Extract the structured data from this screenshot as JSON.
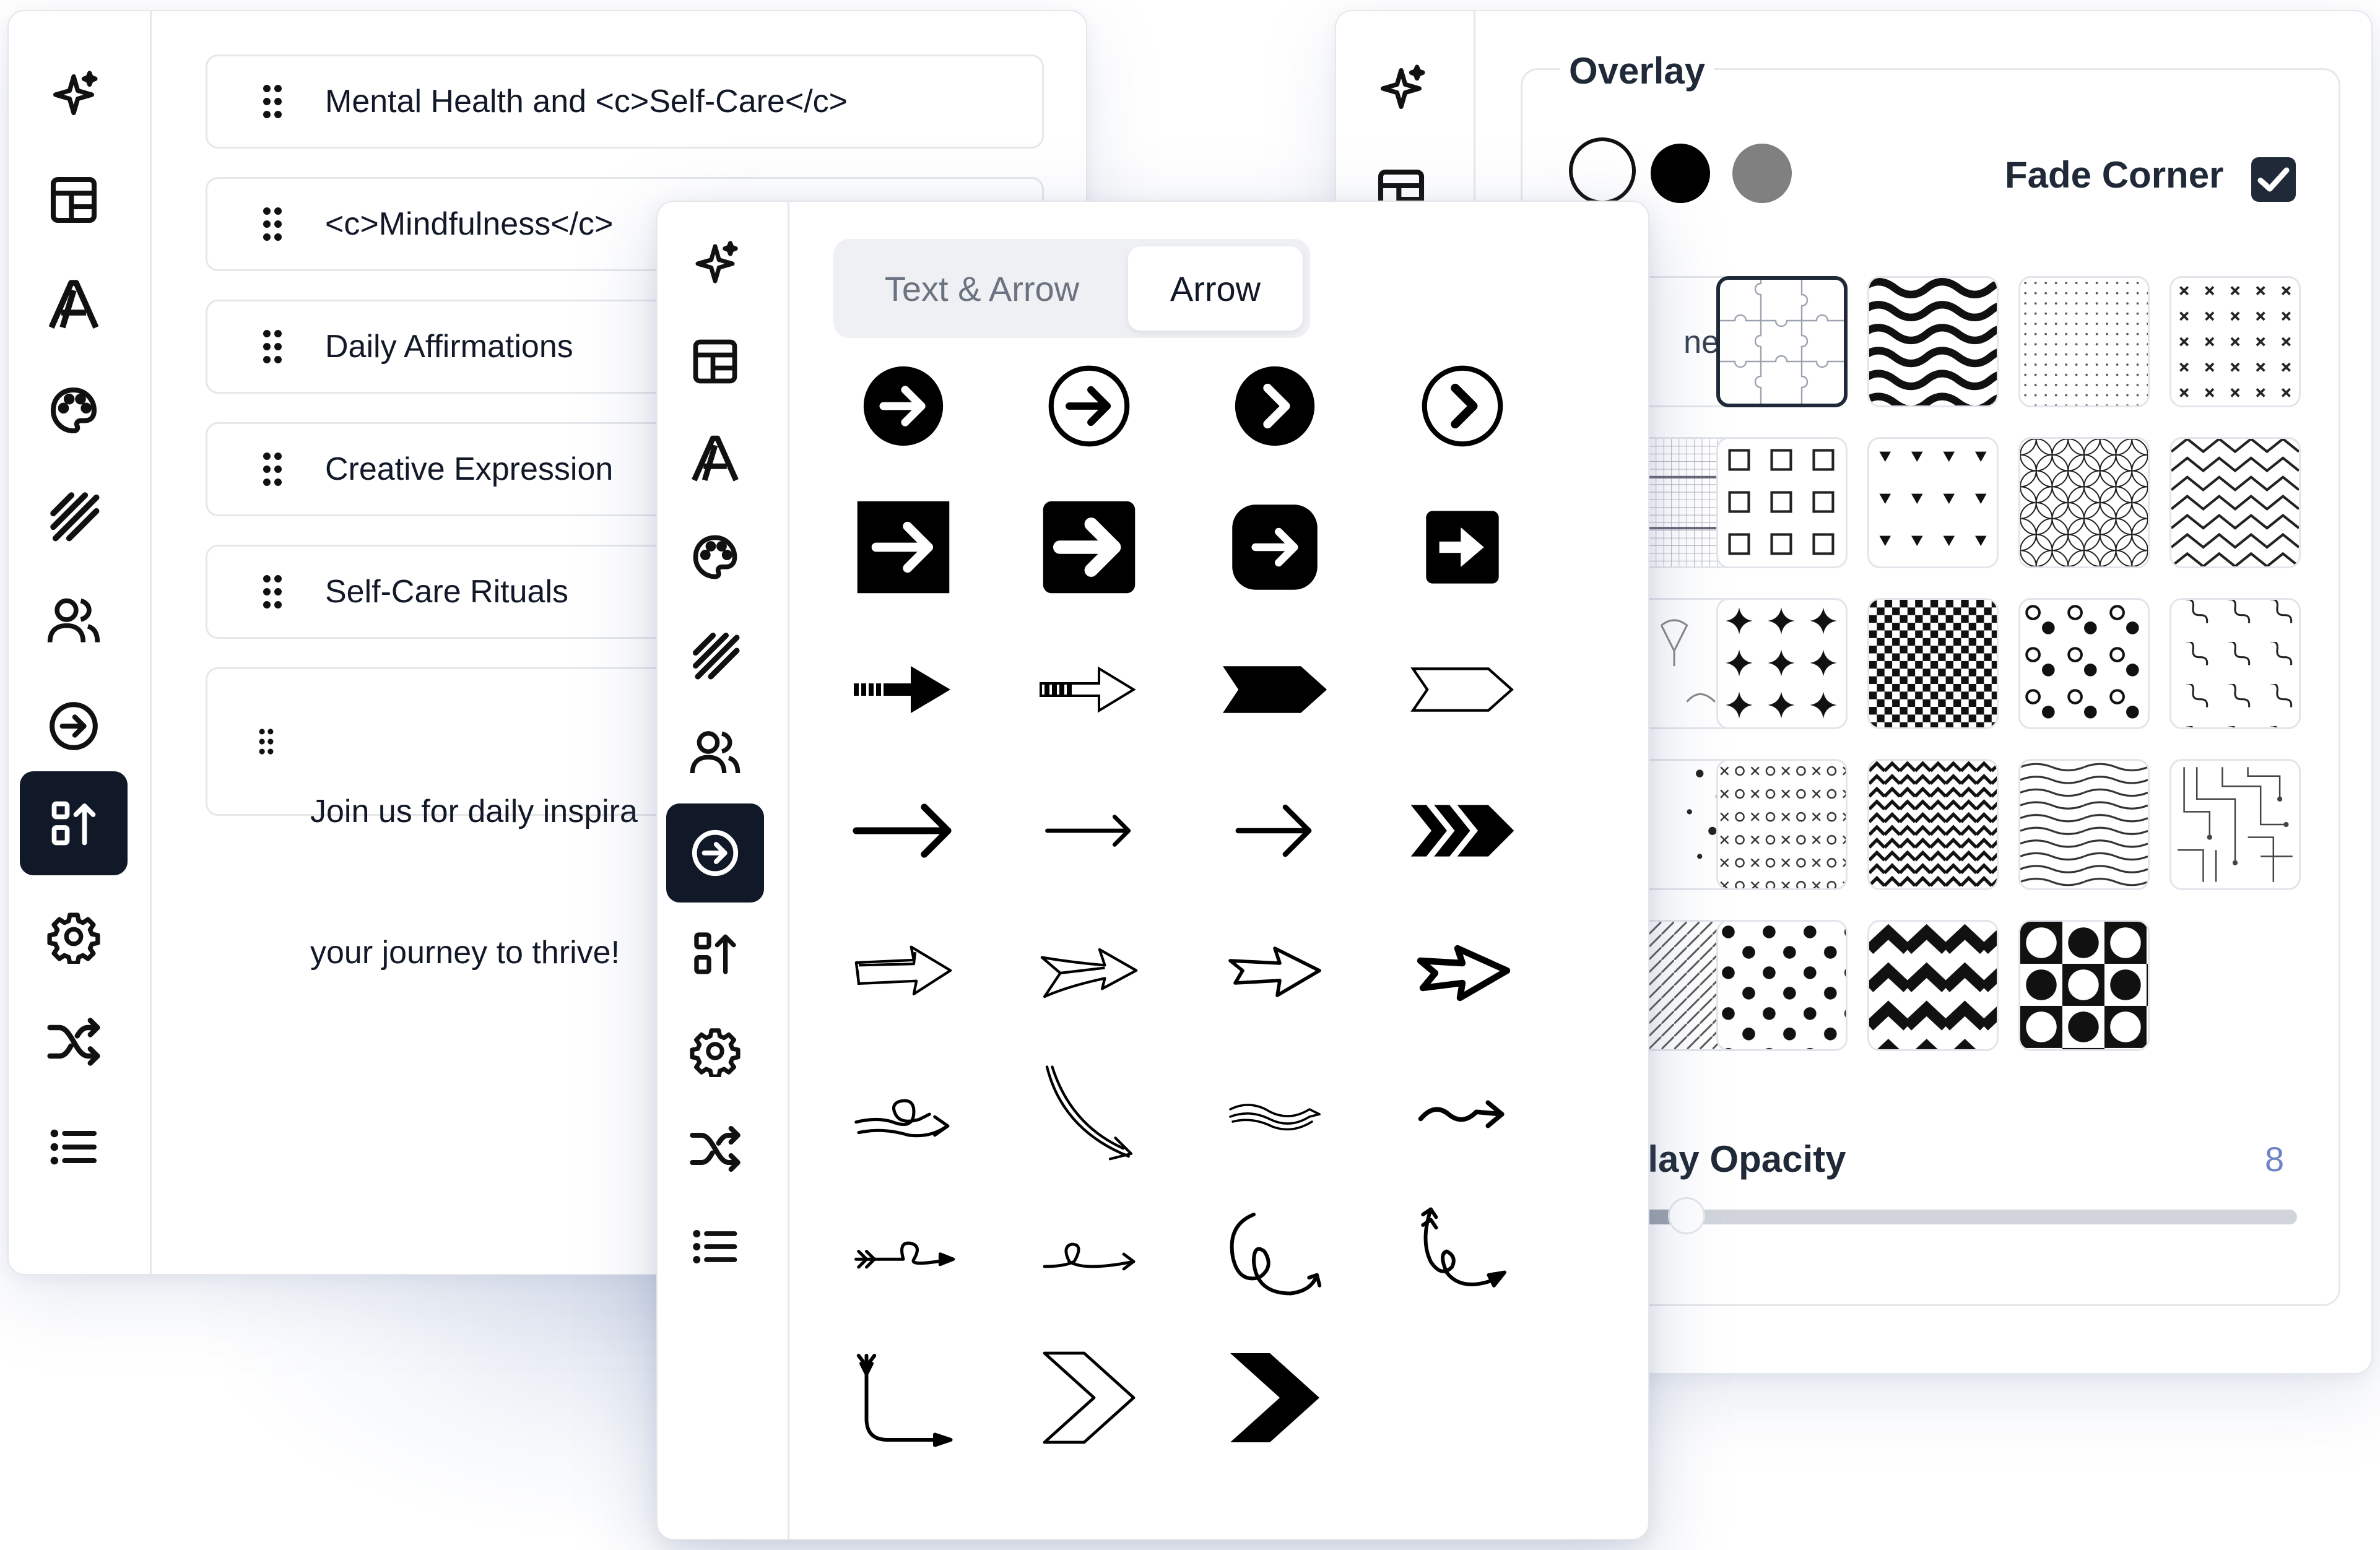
{
  "left_panel": {
    "rail_icons": [
      "sparkle-icon",
      "layout-icon",
      "font-icon",
      "palette-icon",
      "hatch-pattern-icon",
      "users-icon",
      "arrow-circle-icon",
      "sort-icon",
      "gear-icon",
      "shuffle-icon",
      "list-icon"
    ],
    "active_rail_icon": "sort-icon",
    "cards": [
      {
        "text": "Mental Health and <c>Self-Care</c>"
      },
      {
        "text": "<c>Mindfulness</c>"
      },
      {
        "text": "Daily Affirmations"
      },
      {
        "text": "Creative Expression"
      },
      {
        "text": "Self-Care Rituals"
      },
      {
        "line1": "Join us for daily inspira",
        "line2": "your journey to thrive!"
      }
    ]
  },
  "middle_panel": {
    "rail_icons": [
      "sparkle-icon",
      "layout-icon",
      "font-icon",
      "palette-icon",
      "hatch-pattern-icon",
      "users-icon",
      "arrow-circle-icon",
      "sort-icon",
      "gear-icon",
      "shuffle-icon",
      "list-icon"
    ],
    "active_rail_icon": "arrow-circle-icon",
    "tabs": [
      "Text & Arrow",
      "Arrow"
    ],
    "selected_tab": "Arrow",
    "arrow_styles": [
      "filled-circle-arrow",
      "outline-circle-arrow",
      "filled-circle-chevron",
      "outline-circle-chevron",
      "filled-square-arrow",
      "filled-rounded-square-arrow-bold",
      "filled-rounded-square-arrow",
      "filled-small-square-arrow",
      "dashed-tail-filled-arrow",
      "dashed-tail-outline-arrow",
      "filled-tag-arrow",
      "outline-tag-arrow",
      "bold-line-arrow",
      "thin-line-arrow",
      "medium-line-arrow",
      "triple-chevron-arrow",
      "sketch-outline-block-arrow",
      "sketch-feather-arrow",
      "sketch-outline-arrow",
      "sketch-bold-outline-arrow",
      "loop-swirl-arrow",
      "curved-down-arrow",
      "wavy-outline-arrow",
      "squiggle-arrow",
      "fletched-loop-arrow",
      "single-loop-arrow",
      "spiral-arrow",
      "fletched-spiral-arrow",
      "corner-elbow-arrow",
      "outline-chevron",
      "filled-chevron"
    ]
  },
  "right_panel": {
    "rail_icons": [
      "sparkle-icon",
      "layout-icon"
    ],
    "overlay_label": "Overlay",
    "swatches": [
      "#ffffff",
      "#000000",
      "#808080"
    ],
    "fade_corner_label": "Fade Corner",
    "fade_corner_checked": true,
    "none_tile_text": "ne",
    "patterns": [
      "none",
      "puzzle",
      "waves",
      "dots-fine",
      "x-marks",
      "grid-mesh",
      "squares",
      "triangles",
      "circle-lattice",
      "zigzag-fine",
      "doodle",
      "stars",
      "checkerboard",
      "dot-pairs",
      "squiggles",
      "scattered-dots",
      "x-o",
      "zigzag-bold",
      "wavy-lines",
      "circuit",
      "diagonal-lines",
      "polka-dots",
      "zigzag-heavy",
      "circle-check"
    ],
    "selected_pattern": "puzzle",
    "opacity_label": "rlay Opacity",
    "opacity_value": "8",
    "opacity_level": 0.08
  }
}
